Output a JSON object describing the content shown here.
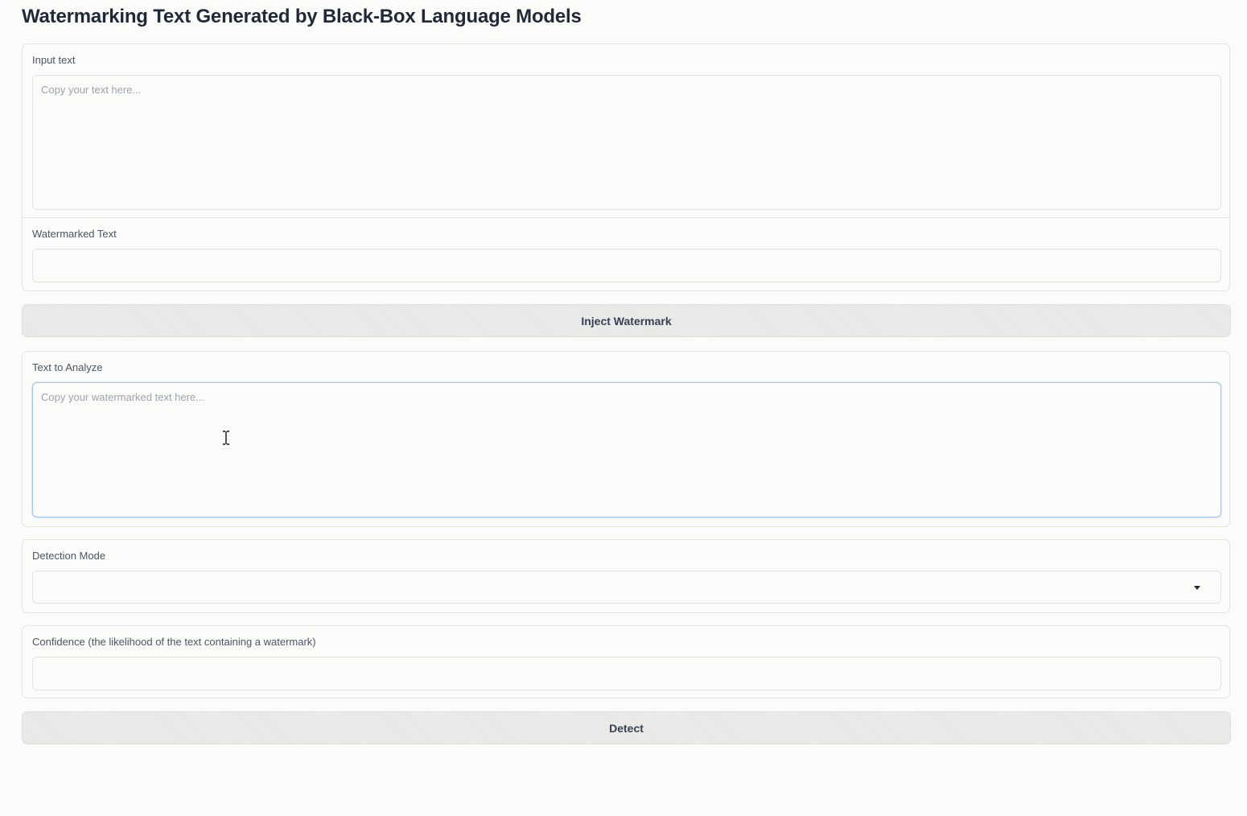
{
  "page": {
    "title": "Watermarking Text Generated by Black-Box Language Models"
  },
  "inject": {
    "input_label": "Input text",
    "input_placeholder": "Copy your text here...",
    "input_value": "",
    "output_label": "Watermarked Text",
    "output_value": "",
    "button_label": "Inject Watermark"
  },
  "detect": {
    "analyze_label": "Text to Analyze",
    "analyze_placeholder": "Copy your watermarked text here...",
    "analyze_value": "",
    "mode_label": "Detection Mode",
    "mode_value": "",
    "mode_icon": "chevron-down-icon",
    "confidence_label": "Confidence (the likelihood of the text containing a watermark)",
    "confidence_value": "",
    "button_label": "Detect"
  },
  "colors": {
    "background": "#fbfbf9",
    "border": "#e6e4dc",
    "focus_border": "#a8c4ee",
    "button_bg": "#ececea",
    "text": "#374151"
  }
}
